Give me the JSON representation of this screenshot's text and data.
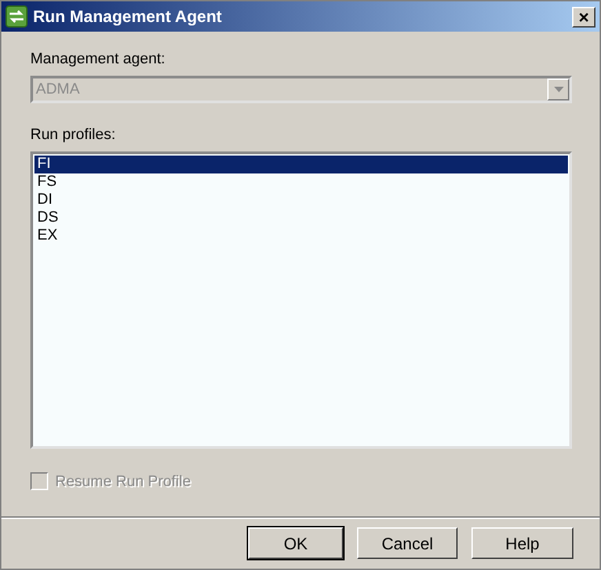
{
  "window": {
    "title": "Run Management Agent",
    "close": "×"
  },
  "agent": {
    "label": "Management agent:",
    "value": "ADMA",
    "disabled": true
  },
  "profiles": {
    "label": "Run profiles:",
    "items": [
      {
        "label": "FI",
        "selected": true
      },
      {
        "label": "FS",
        "selected": false
      },
      {
        "label": "DI",
        "selected": false
      },
      {
        "label": "DS",
        "selected": false
      },
      {
        "label": "EX",
        "selected": false
      }
    ]
  },
  "resume": {
    "label": "Resume Run Profile",
    "checked": false,
    "disabled": true
  },
  "buttons": [
    {
      "label": "OK",
      "default": true
    },
    {
      "label": "Cancel",
      "default": false
    },
    {
      "label": "Help",
      "default": false
    }
  ]
}
